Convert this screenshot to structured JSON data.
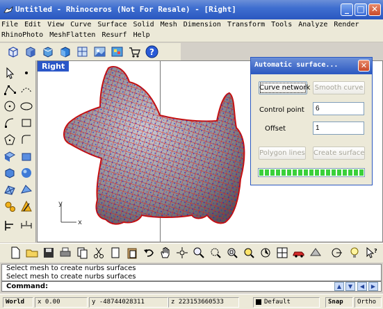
{
  "window": {
    "title": "Untitled - Rhinoceros (Not For Resale) - [Right]",
    "minimize_glyph": "_",
    "maximize_glyph": "□",
    "close_glyph": "✕"
  },
  "menu": {
    "row1": [
      "File",
      "Edit",
      "View",
      "Curve",
      "Surface",
      "Solid",
      "Mesh",
      "Dimension",
      "Transform",
      "Tools",
      "Analyze",
      "Render"
    ],
    "row2": [
      "RhinoPhoto",
      "MeshFlatten",
      "Resurf",
      "Help"
    ]
  },
  "top_toolbar": {
    "icons": [
      "cube-wire-icon",
      "cube-shaded-icon",
      "cube-render-icon",
      "cube-solid-icon",
      "cube-ghost-icon",
      "texture-icon",
      "palette-icon",
      "cart-icon",
      "help-icon"
    ]
  },
  "viewport": {
    "label": "Right",
    "axis_x": "x",
    "axis_y": "y"
  },
  "dialog": {
    "title": "Automatic surface...",
    "close_glyph": "✕",
    "curve_network_label": "Curve network",
    "smooth_curve_label": "Smooth curve",
    "control_point_label": "Control point",
    "control_point_value": "6",
    "offset_label": "Offset",
    "offset_value": "1",
    "polygon_lines_label": "Polygon lines",
    "create_surface_label": "Create surface",
    "progress": 1.0
  },
  "command": {
    "history": [
      "Select mesh to create nurbs surfaces",
      "Select mesh to create nurbs surfaces"
    ],
    "prompt": "Command:"
  },
  "status": {
    "cplane": "World",
    "x": "x 0.00",
    "y": "y -48744028311",
    "z": "z 223153660533",
    "layer": "Default",
    "snap": "Snap",
    "ortho": "Ortho"
  },
  "colors": {
    "mesh_red": "#e01818",
    "mesh_blue": "#1a1ad0",
    "surface_gray": "#8e8e96",
    "title_blue": "#2a57c0"
  }
}
